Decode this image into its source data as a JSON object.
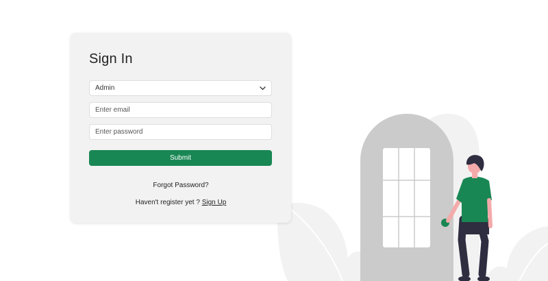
{
  "form": {
    "title": "Sign In",
    "role_select": {
      "value": "Admin"
    },
    "email": {
      "placeholder": "Enter email",
      "value": ""
    },
    "password": {
      "placeholder": "Enter password",
      "value": ""
    },
    "submit_label": "Submit",
    "forgot_label": "Forgot Password?",
    "register_prompt": "Haven't register yet ?",
    "signup_label": "Sign Up"
  },
  "colors": {
    "accent": "#198754",
    "card_background": "#f2f2f2",
    "shirt": "#198754",
    "door": "#cbcbcb",
    "leaves": "#f2f2f2"
  }
}
